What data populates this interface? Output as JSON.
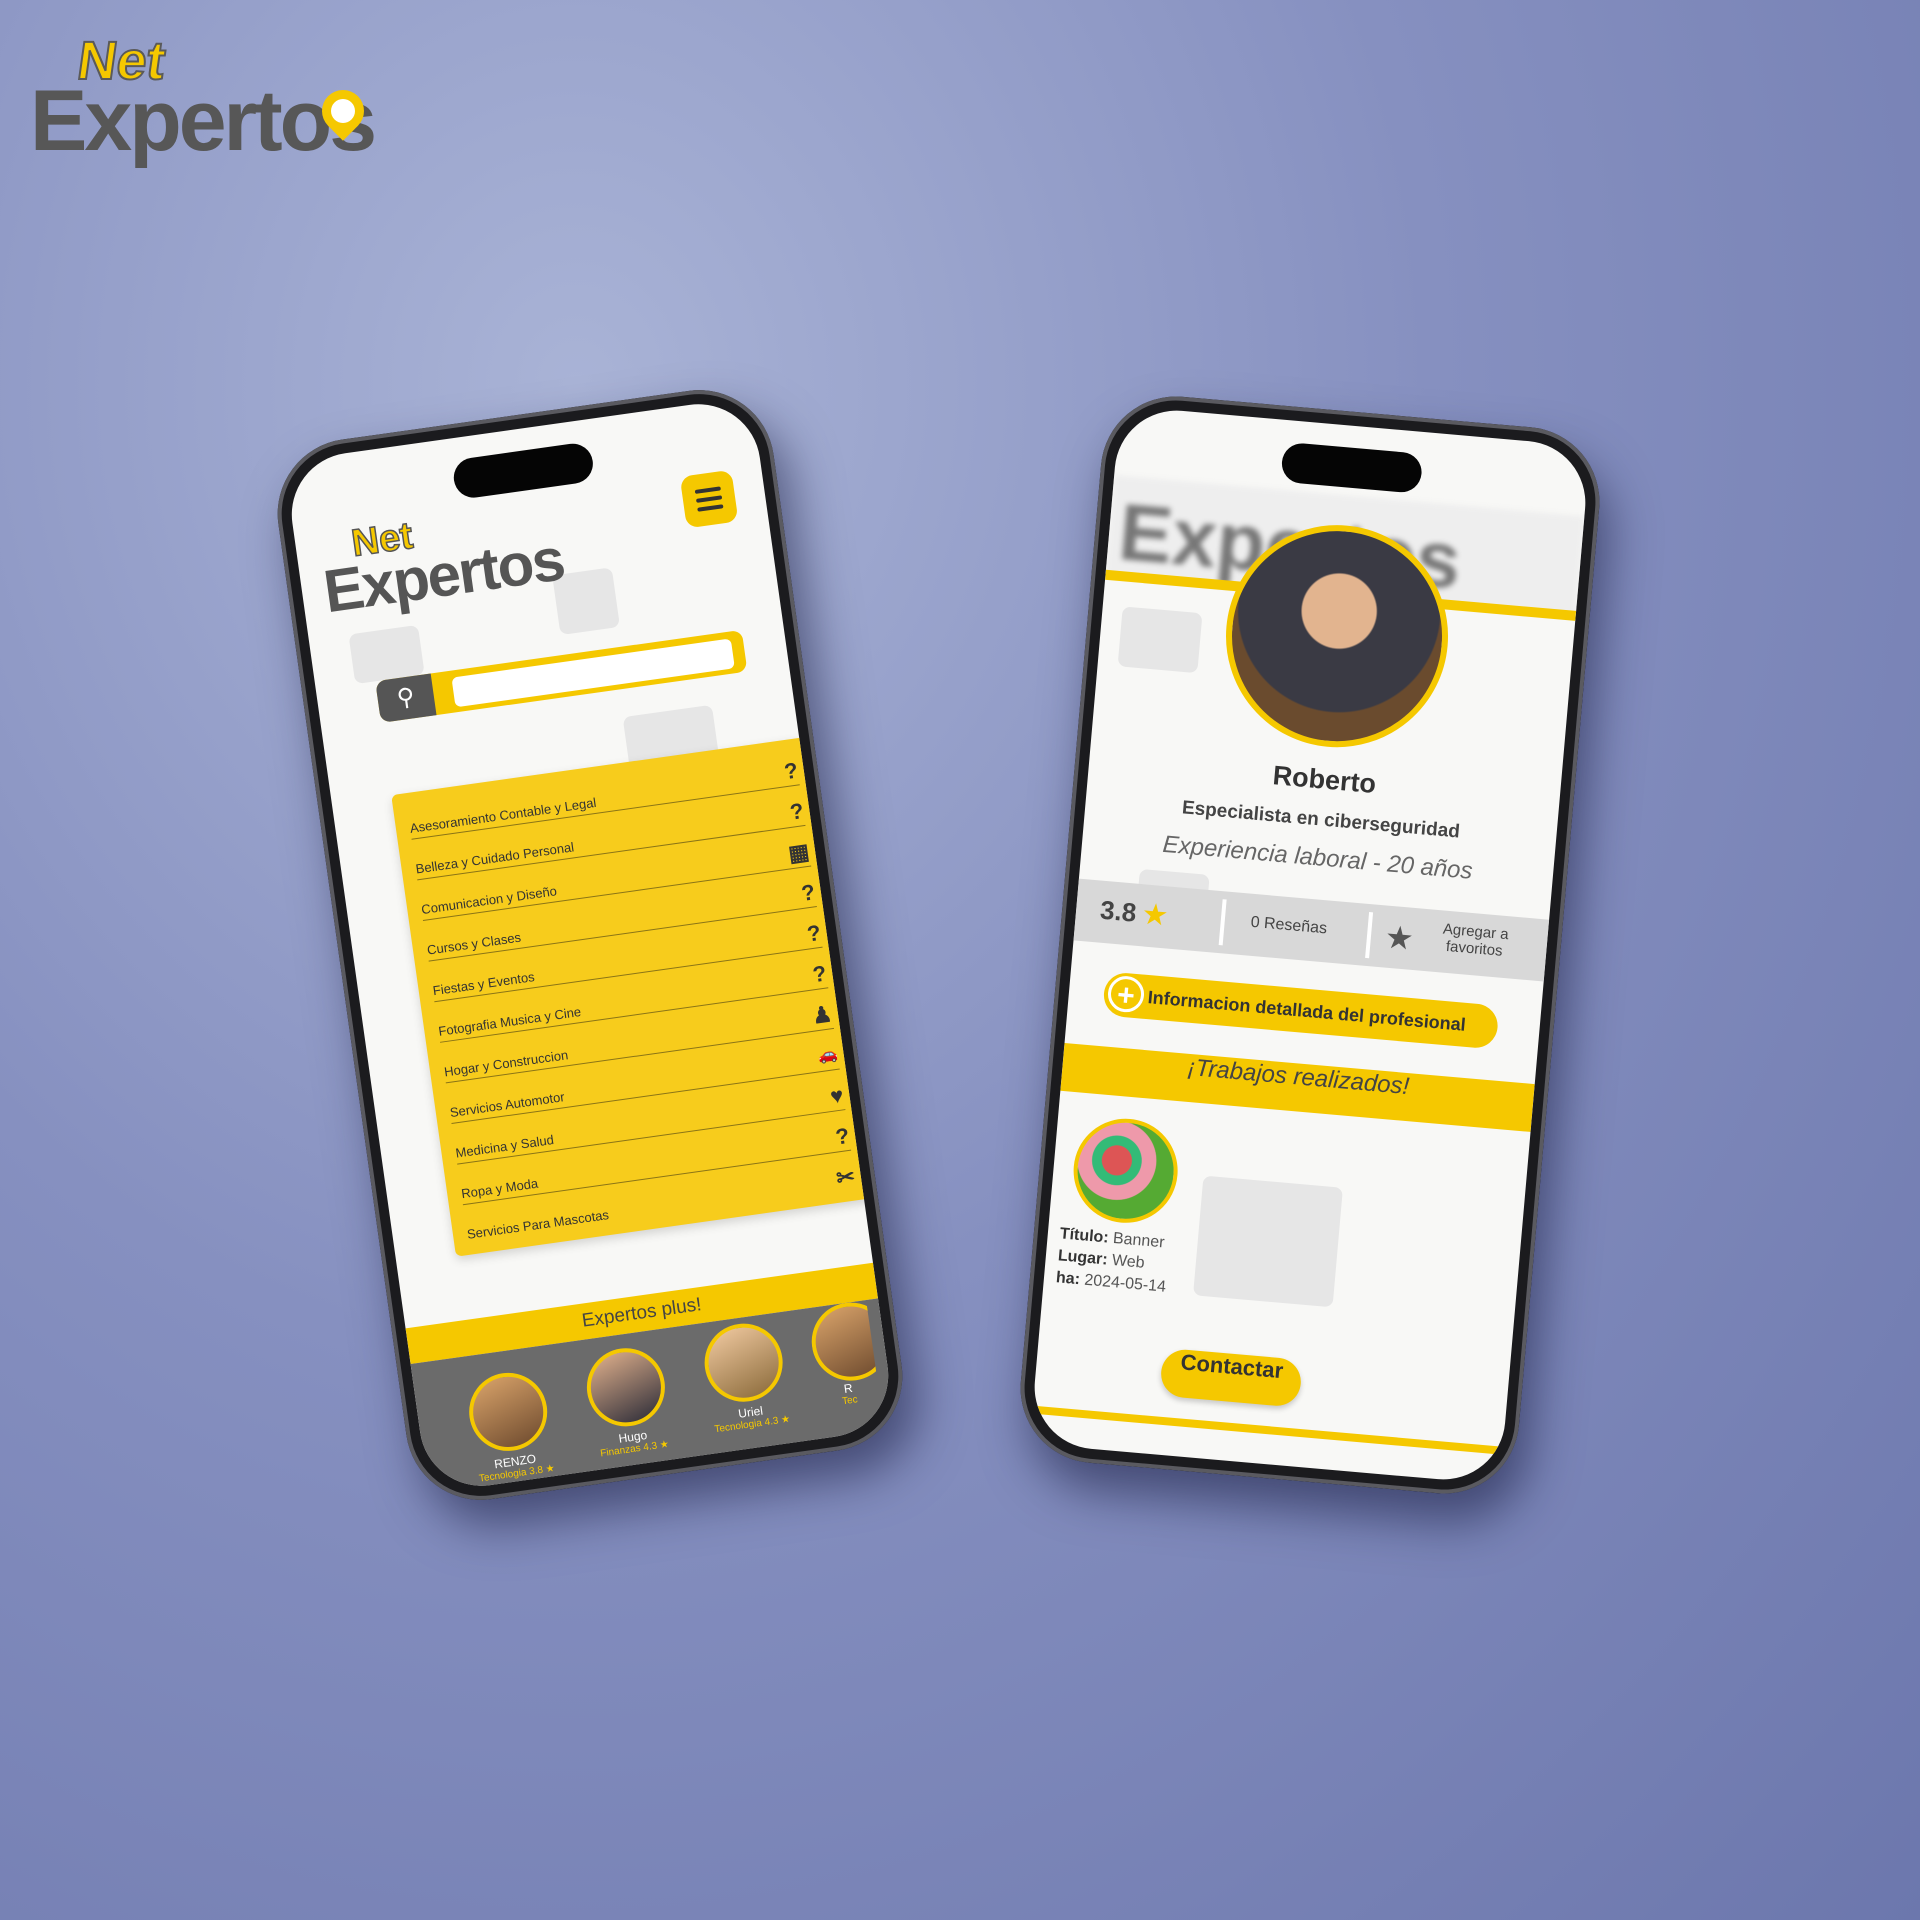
{
  "brand": {
    "net": "Net",
    "expertos": "Expertos"
  },
  "colors": {
    "accent": "#f5c800",
    "dark": "#555555",
    "background": "#8690c0"
  },
  "left_screen": {
    "logo_net": "Net",
    "logo_expertos": "Expertos",
    "menu_icon": "hamburger-icon",
    "search_icon": "search-icon",
    "search_placeholder": "",
    "categories": [
      {
        "label": "Asesoramiento Contable y Legal",
        "icon": "?"
      },
      {
        "label": "Belleza y Cuidado Personal",
        "icon": "?"
      },
      {
        "label": "Comunicacion y Diseño",
        "icon": "▦"
      },
      {
        "label": "Cursos y Clases",
        "icon": "?"
      },
      {
        "label": "Fiestas y Eventos",
        "icon": "?"
      },
      {
        "label": "Fotografia Musica y Cine",
        "icon": "?"
      },
      {
        "label": "Hogar y Construccion",
        "icon": "♟"
      },
      {
        "label": "Servicios Automotor",
        "icon": "🚗"
      },
      {
        "label": "Medicina y Salud",
        "icon": "♥"
      },
      {
        "label": "Ropa y Moda",
        "icon": "?"
      },
      {
        "label": "Servicios Para Mascotas",
        "icon": "✂"
      }
    ],
    "plus_title": "Expertos plus!",
    "experts": [
      {
        "name": "RENZO",
        "category": "Tecnologia",
        "rating": "3.8"
      },
      {
        "name": "Hugo",
        "category": "Finanzas",
        "rating": "4.3"
      },
      {
        "name": "Uriel",
        "category": "Tecnologia",
        "rating": "4.3"
      },
      {
        "name": "R",
        "category": "Tec",
        "rating": ""
      }
    ]
  },
  "right_screen": {
    "name": "Roberto",
    "role": "Especialista en ciberseguridad",
    "experience": "Experiencia laboral - 20 años",
    "rating": "3.8",
    "reviews": "0 Reseñas",
    "favorite_line1": "Agregar a",
    "favorite_line2": "favoritos",
    "info_button": "Informacion detallada del profesional",
    "jobs_title": "¡Trabajos realizados!",
    "job_meta": [
      {
        "key": "Título:",
        "value": "Banner"
      },
      {
        "key": "Lugar:",
        "value": "Web"
      },
      {
        "key": "ha:",
        "value": "2024-05-14"
      }
    ],
    "contact_button": "Contactar"
  }
}
